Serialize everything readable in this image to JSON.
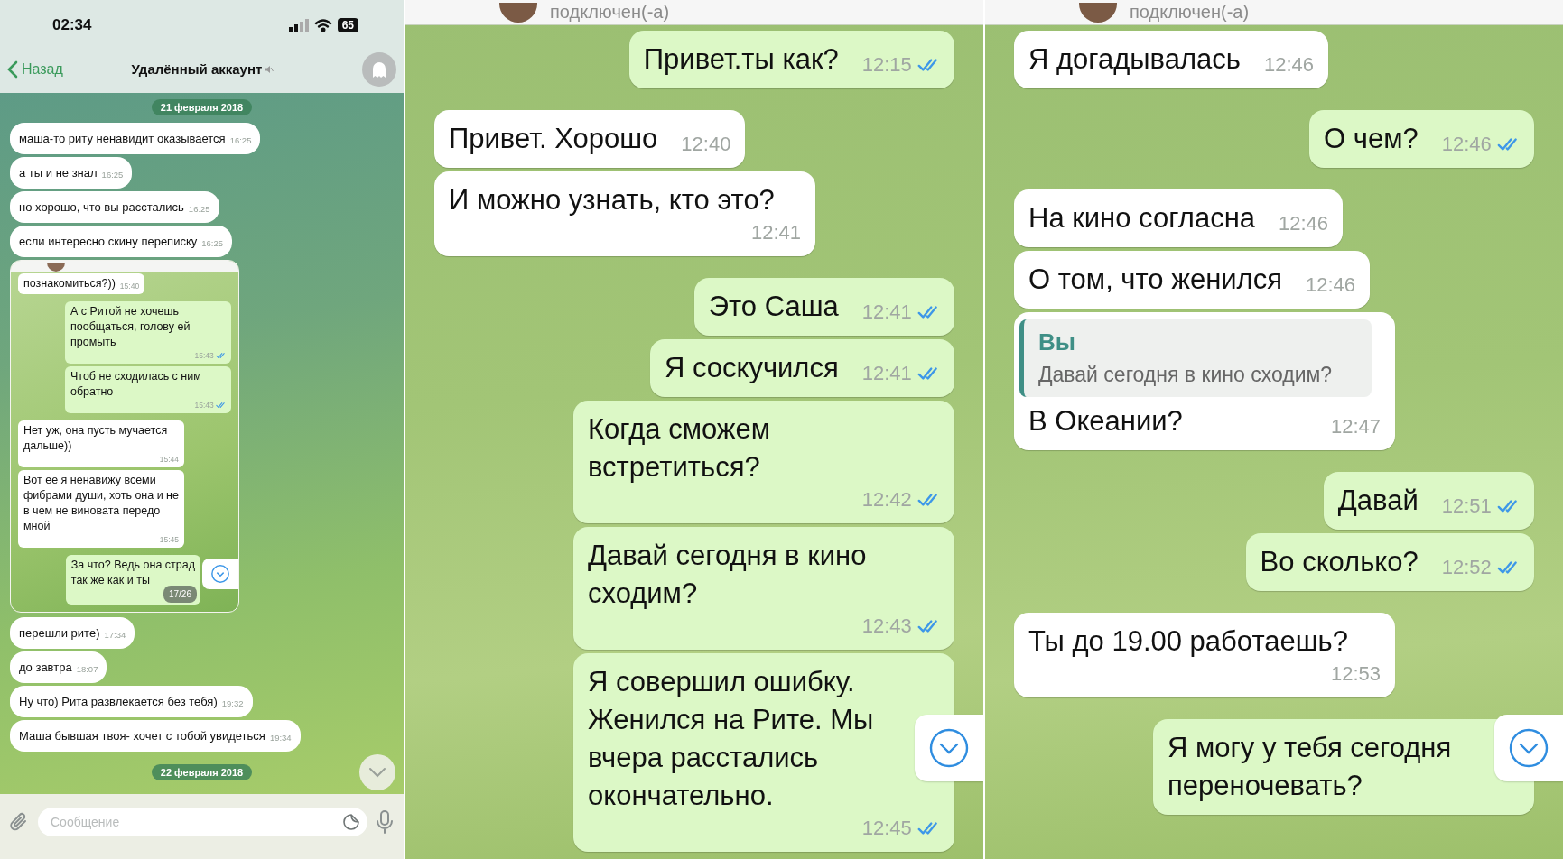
{
  "left_phone": {
    "status_bar": {
      "time": "02:34",
      "battery": "65"
    },
    "header": {
      "back_label": "Назад",
      "title": "Удалённый аккаунт"
    },
    "messages": [
      {
        "kind": "date",
        "text": "21 февраля 2018"
      },
      {
        "kind": "in",
        "text": "маша-то риту ненавидит оказывается",
        "time": "16:25",
        "read": false
      },
      {
        "kind": "in",
        "text": "а ты и не знал",
        "time": "16:25",
        "read": false
      },
      {
        "kind": "in",
        "text": "но хорошо, что вы расстались",
        "time": "16:25",
        "read": false
      },
      {
        "kind": "in",
        "text": "если интересно скину переписку",
        "time": "16:25",
        "read": false
      },
      {
        "kind": "screenshot",
        "badge": "17/26",
        "messages": [
          {
            "kind": "in",
            "text": "познакомиться?))",
            "time": "15:40",
            "read": false
          },
          {
            "kind": "out",
            "text": "А с Ритой не хочешь пообщаться, голову ей промыть",
            "time": "15:43",
            "read": true
          },
          {
            "kind": "out",
            "text": "Чтоб не сходилась с ним обратно",
            "time": "15:43",
            "read": true
          },
          {
            "kind": "in",
            "text": "Нет уж, она пусть мучается дальше))",
            "time": "15:44",
            "read": false
          },
          {
            "kind": "in",
            "text": "Вот ее я ненавижу всеми фибрами души, хоть она и не в чем не виновата передо мной",
            "time": "15:45",
            "read": false
          },
          {
            "kind": "out",
            "text": "За что? Ведь она страд\nтак же как и ты",
            "read": false
          }
        ]
      },
      {
        "kind": "in",
        "text": "перешли рите)",
        "time": "17:34",
        "read": false
      },
      {
        "kind": "in",
        "text": "до завтра",
        "time": "18:07",
        "read": false
      },
      {
        "kind": "in",
        "text": "Ну что) Рита развлекается без тебя)",
        "time": "19:32",
        "read": false
      },
      {
        "kind": "in",
        "text": "Маша бывшая твоя- хочет с тобой увидеться",
        "time": "19:34",
        "read": false
      },
      {
        "kind": "date",
        "text": "22 февраля 2018"
      }
    ],
    "input": {
      "placeholder": "Сообщение"
    }
  },
  "middle_phone": {
    "header": {
      "status": "подключен(-а)"
    },
    "messages": [
      {
        "kind": "out",
        "text": "Привет.ты как?",
        "time": "12:15",
        "read": true
      },
      {
        "kind": "in",
        "text": "Привет. Хорошо",
        "time": "12:40",
        "read": false
      },
      {
        "kind": "in",
        "text": "И можно узнать, кто это?",
        "time": "12:41",
        "read": false
      },
      {
        "kind": "out",
        "text": "Это Саша",
        "time": "12:41",
        "read": true
      },
      {
        "kind": "out",
        "text": "Я соскучился",
        "time": "12:41",
        "read": true
      },
      {
        "kind": "out",
        "text": "Когда сможем встретиться?",
        "time": "12:42",
        "read": true
      },
      {
        "kind": "out",
        "text": "Давай сегодня в кино сходим?",
        "time": "12:43",
        "read": true
      },
      {
        "kind": "out",
        "text": "Я совершил ошибку. Женился на Рите. Мы вчера расстались окончательно.",
        "time": "12:45",
        "read": true
      }
    ]
  },
  "right_phone": {
    "header": {
      "status": "подключен(-а)"
    },
    "messages": [
      {
        "kind": "in",
        "text": "Я догадывалась",
        "time": "12:46",
        "read": false
      },
      {
        "kind": "out",
        "text": "О чем?",
        "time": "12:46",
        "read": true
      },
      {
        "kind": "in",
        "text": "На кино согласна",
        "time": "12:46",
        "read": false
      },
      {
        "kind": "in",
        "text": "О том, что женился",
        "time": "12:46",
        "read": false
      },
      {
        "kind": "in",
        "text": "В Океании?",
        "time": "12:47",
        "read": false,
        "reply": {
          "author": "Вы",
          "text": "Давай сегодня в кино сходим?"
        }
      },
      {
        "kind": "out",
        "text": "Давай",
        "time": "12:51",
        "read": true
      },
      {
        "kind": "out",
        "text": "Во сколько?",
        "time": "12:52",
        "read": true
      },
      {
        "kind": "in",
        "text": "Ты до 19.00 работаешь?",
        "time": "12:53",
        "read": false
      },
      {
        "kind": "out",
        "text": "Я могу у тебя сегодня переночевать?",
        "read": false
      }
    ]
  }
}
